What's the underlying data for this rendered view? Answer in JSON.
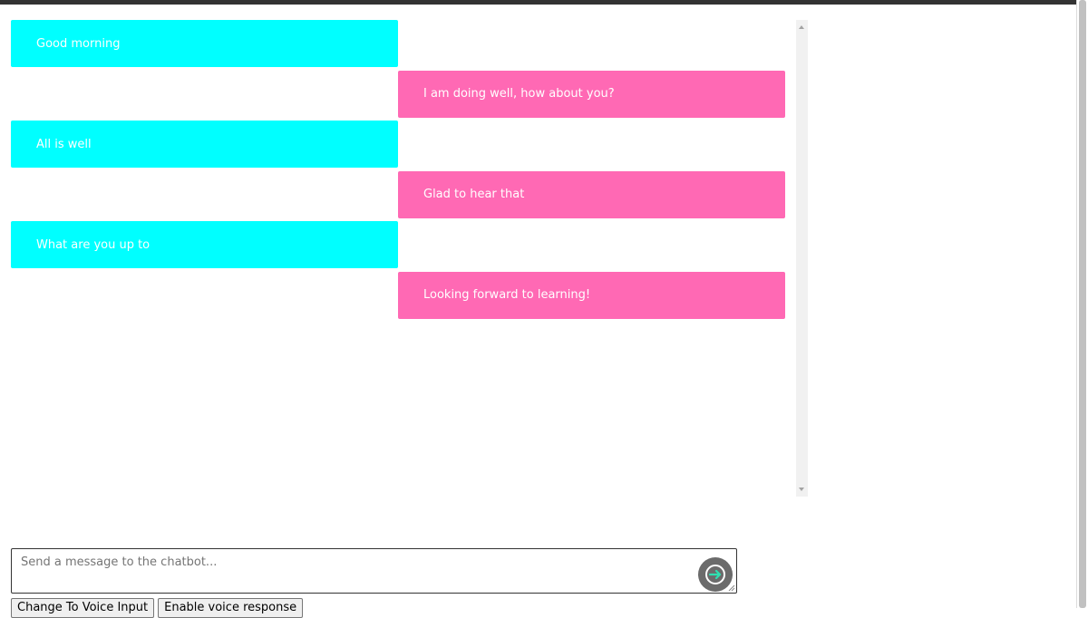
{
  "colors": {
    "bot_bubble": "#00ffff",
    "user_bubble": "#ff69b4",
    "send_button": "#6b6b6b",
    "send_arrow": "#2ee0b0"
  },
  "chat": {
    "messages": [
      {
        "sender": "bot",
        "text": "Good morning"
      },
      {
        "sender": "user",
        "text": "I am doing well, how about you?"
      },
      {
        "sender": "bot",
        "text": "All is well"
      },
      {
        "sender": "user",
        "text": "Glad to hear that"
      },
      {
        "sender": "bot",
        "text": "What are you up to"
      },
      {
        "sender": "user",
        "text": "Looking forward to learning!"
      }
    ]
  },
  "composer": {
    "placeholder": "Send a message to the chatbot...",
    "value": "",
    "send_icon": "arrow-right-circle-icon"
  },
  "controls": {
    "voice_input_label": "Change To Voice Input",
    "voice_response_label": "Enable voice response"
  }
}
